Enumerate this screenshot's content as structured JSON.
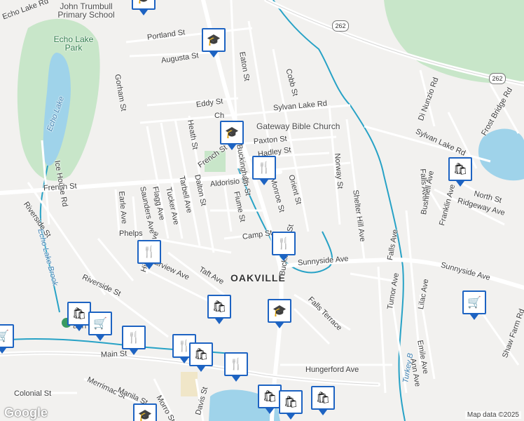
{
  "map": {
    "area_label": "OAKVILLE",
    "park_label": "Echo Lake Park",
    "water_labels": {
      "lake": "Echo Lake",
      "brook": "Echo Lake Brook",
      "turkey": "Turkey B"
    },
    "poi_labels": {
      "school": "John Trumbull Primary School",
      "church": "Gateway Bible Church",
      "gym": "ach Gym"
    },
    "route_shields": [
      "262",
      "262"
    ],
    "streets": [
      "Echo Lake Rd",
      "Portland St",
      "Gorham St",
      "Augusta St",
      "Eaton St",
      "Cobb St",
      "Eddy St",
      "Sylvan Lake Rd",
      "Paxton St",
      "Hadley St",
      "French St",
      "French St",
      "Aldorisio St",
      "Heath St",
      "Dalton St",
      "Tarbell Ave",
      "Tucker Ave",
      "Flagg Ave",
      "Saunders Ave",
      "Earle Ave",
      "Ice House Rd",
      "Riverside St",
      "Riverside St",
      "Phelps",
      "Fiume St",
      "Monroe St",
      "Orient St",
      "Norway St",
      "Shelter Hill Ave",
      "Camp St",
      "Sunnyside Ave",
      "Sunnyside Ave",
      "Falls Ave",
      "Bushnell Ave",
      "Franklin Ave",
      "Ridgeway Ave",
      "North St",
      "Frost Bridge Rd",
      "Di Nunzio Rd",
      "Sylvan Lake Rd",
      "Hillcrest Ave",
      "Fairview Ave",
      "Taft Ave",
      "Falls Terrace",
      "Hungerford Ave",
      "Main St",
      "Colonial St",
      "Merrimac St",
      "Manila St",
      "Morro St",
      "Davis St",
      "Tumor Ave",
      "Lilac Ave",
      "Emile Ave",
      "Ann Ave",
      "Shaw Farm Rd",
      "Buckingham St",
      "Buckingham St",
      "Falls Ave",
      "Ch"
    ],
    "markers": [
      {
        "type": "school",
        "icon": "school-icon"
      },
      {
        "type": "school",
        "icon": "school-icon"
      },
      {
        "type": "school",
        "icon": "school-icon"
      },
      {
        "type": "school",
        "icon": "school-icon"
      },
      {
        "type": "restaurant",
        "icon": "restaurant-icon"
      },
      {
        "type": "restaurant",
        "icon": "restaurant-icon"
      },
      {
        "type": "restaurant",
        "icon": "restaurant-icon"
      },
      {
        "type": "restaurant",
        "icon": "restaurant-icon"
      },
      {
        "type": "restaurant",
        "icon": "restaurant-icon"
      },
      {
        "type": "shopping",
        "icon": "shopping-bag-icon"
      },
      {
        "type": "shopping",
        "icon": "shopping-bag-icon"
      },
      {
        "type": "shopping",
        "icon": "shopping-bag-icon"
      },
      {
        "type": "shopping",
        "icon": "shopping-bag-icon"
      },
      {
        "type": "shopping",
        "icon": "shopping-bag-icon"
      },
      {
        "type": "shopping",
        "icon": "shopping-bag-icon"
      },
      {
        "type": "grocery",
        "icon": "shopping-cart-icon"
      },
      {
        "type": "grocery",
        "icon": "shopping-cart-icon"
      },
      {
        "type": "grocery",
        "icon": "shopping-cart-icon"
      }
    ],
    "attribution": "Map data ©2025",
    "logo": "Google"
  },
  "colors": {
    "marker_border": "#1d63c2",
    "water": "#9fd3ea",
    "park": "#c8e6c9",
    "brook": "#27a2c6"
  }
}
